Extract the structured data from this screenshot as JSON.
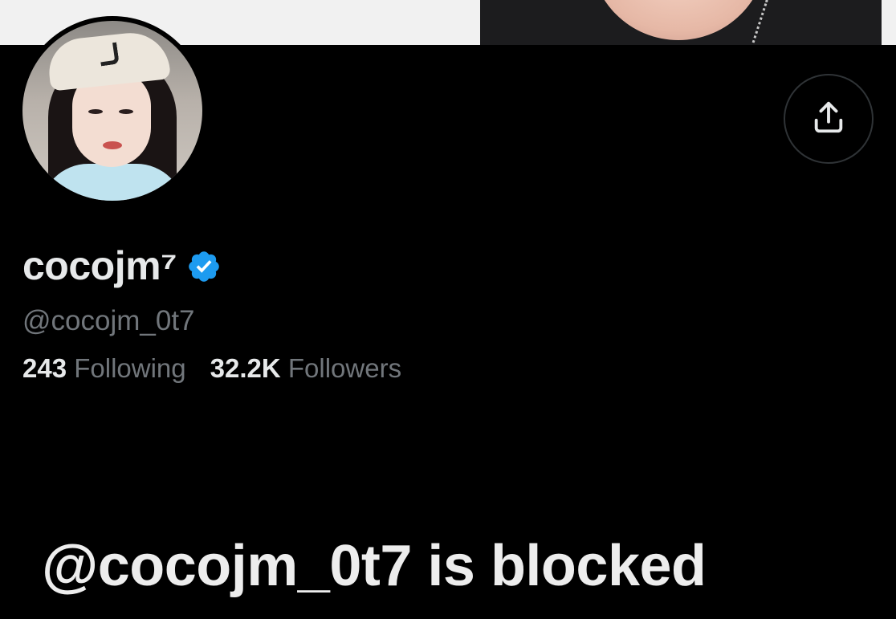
{
  "profile": {
    "display_name": "cocojm⁷",
    "handle": "@cocojm_0t7",
    "verified": true,
    "following_count": "243",
    "following_label": "Following",
    "followers_count": "32.2K",
    "followers_label": "Followers"
  },
  "header": {
    "share_icon": "share-icon"
  },
  "overlay": {
    "caption": "@cocojm_0t7 is blocked"
  },
  "colors": {
    "background": "#000000",
    "verified_blue": "#1d9bf0",
    "secondary_text": "#71767b",
    "primary_text": "#e7e9ea"
  }
}
